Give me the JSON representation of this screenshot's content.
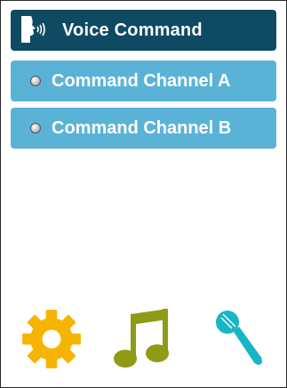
{
  "header": {
    "title": "Voice Command",
    "icon": "speaking-head-icon",
    "color": "#0f4a63"
  },
  "channels": [
    {
      "label": "Command Channel A",
      "icon": "radio-dot-icon"
    },
    {
      "label": "Command Channel B",
      "icon": "radio-dot-icon"
    }
  ],
  "channel_color": "#5ab3d7",
  "bottom_bar": {
    "settings": {
      "icon": "gear-icon",
      "color": "#f6b400"
    },
    "music": {
      "icon": "music-note-icon",
      "color": "#8f9b16"
    },
    "microphone": {
      "icon": "microphone-icon",
      "color": "#16b6c6"
    }
  }
}
